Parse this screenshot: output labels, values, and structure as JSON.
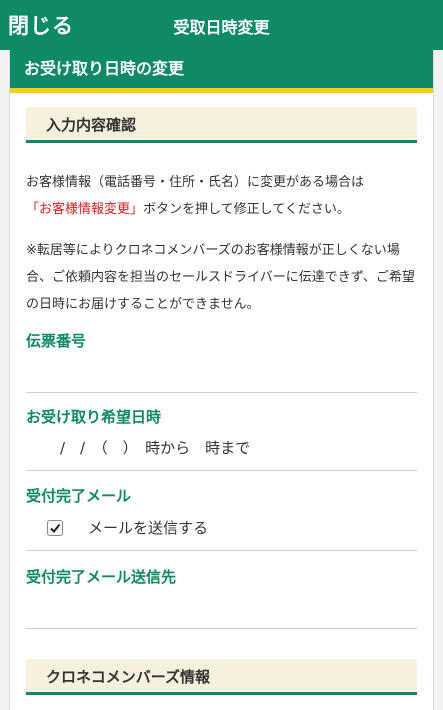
{
  "topbar": {
    "close_label": "閉じる",
    "title": "受取日時変更"
  },
  "card": {
    "title": "お受け取り日時の変更"
  },
  "sections": {
    "confirm_title": "入力内容確認",
    "members_title": "クロネコメンバーズ情報"
  },
  "notice": {
    "line1": "お客様情報（電話番号・住所・氏名）に変更がある場合は",
    "link": "「お客様情報変更」",
    "line2_rest": "ボタンを押して修正してください。",
    "note": "※転居等によりクロネコメンバーズのお客様情報が正しくない場合、ご依頼内容を担当のセールスドライバーに伝達できず、ご希望の日時にお届けすることができません。"
  },
  "fields": {
    "tracking_number_label": "伝票番号",
    "tracking_number_value": "",
    "desired_datetime_label": "お受け取り希望日時",
    "desired_datetime_value": "/　/　（　）　時から　時まで",
    "confirm_mail_label": "受付完了メール",
    "send_mail_label": "メールを送信する",
    "send_mail_checked": true,
    "mail_destination_label": "受付完了メール送信先",
    "mail_destination_value": ""
  },
  "colors": {
    "brand_green": "#0e8a67",
    "accent_yellow": "#f3d11a",
    "warning_red": "#e21a1a"
  }
}
